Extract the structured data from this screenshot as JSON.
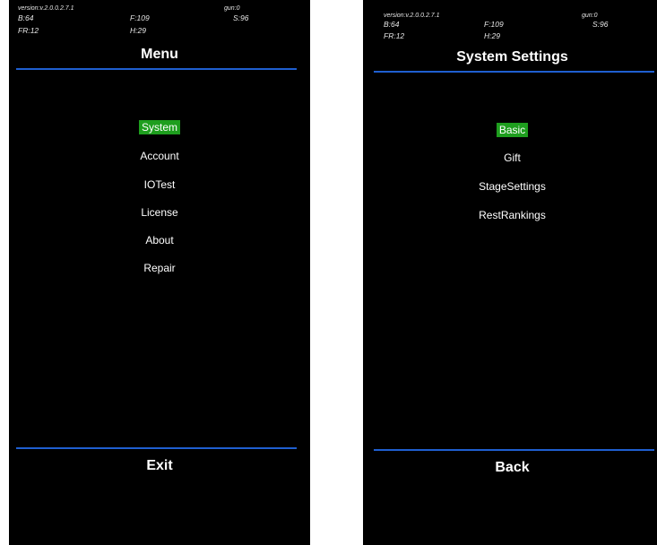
{
  "debug": {
    "version": "version:v.2.0.0.2.7.1",
    "gun": "gun:0",
    "b": "B:64",
    "f": "F:109",
    "s": "S:96",
    "fr": "FR:12",
    "h": "H:29"
  },
  "menu_screen": {
    "title": "Menu",
    "items": [
      {
        "label": "System",
        "selected": true
      },
      {
        "label": "Account",
        "selected": false
      },
      {
        "label": "IOTest",
        "selected": false
      },
      {
        "label": "License",
        "selected": false
      },
      {
        "label": "About",
        "selected": false
      },
      {
        "label": "Repair",
        "selected": false
      }
    ],
    "footer": "Exit"
  },
  "settings_screen": {
    "title": "System Settings",
    "items": [
      {
        "label": "Basic",
        "selected": true
      },
      {
        "label": "Gift",
        "selected": false
      },
      {
        "label": "StageSettings",
        "selected": false
      },
      {
        "label": "RestRankings",
        "selected": false
      }
    ],
    "footer": "Back"
  },
  "colors": {
    "background": "#000000",
    "accent_line": "#1f5fd0",
    "selection": "#1e9e1e",
    "text": "#ffffff"
  }
}
